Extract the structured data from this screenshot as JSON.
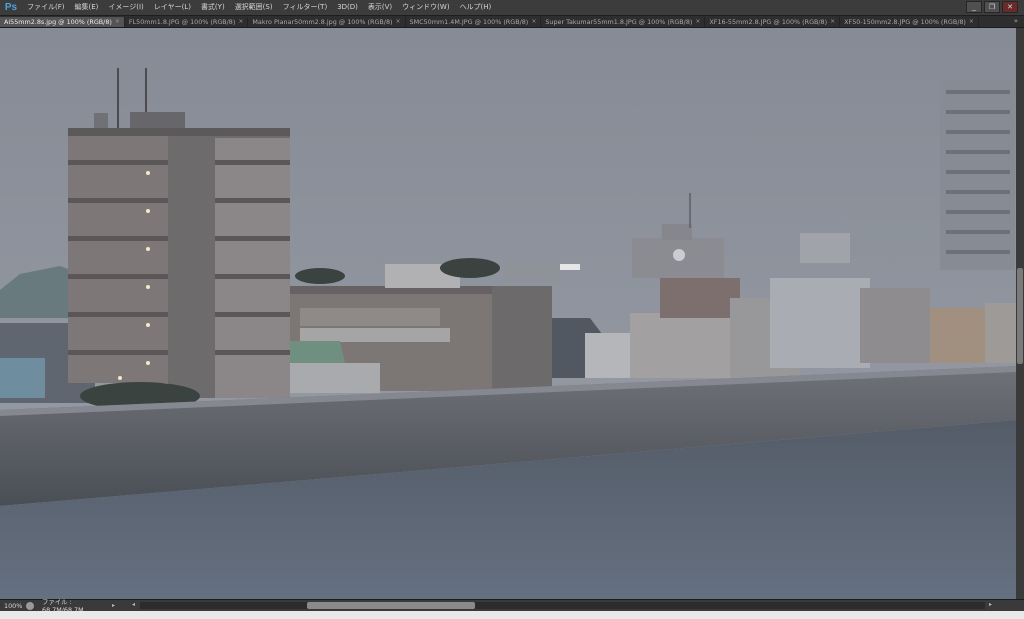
{
  "app": {
    "logo": "Ps"
  },
  "menu": [
    "ファイル(F)",
    "編集(E)",
    "イメージ(I)",
    "レイヤー(L)",
    "書式(Y)",
    "選択範囲(S)",
    "フィルター(T)",
    "3D(D)",
    "表示(V)",
    "ウィンドウ(W)",
    "ヘルプ(H)"
  ],
  "window_controls": {
    "minimize": "_",
    "restore": "❐",
    "close": "✕"
  },
  "tabs": [
    {
      "label": "Ai55mm2.8s.jpg @ 100% (RGB/8)",
      "active": true
    },
    {
      "label": "FL50mm1.8.JPG @ 100% (RGB/8)",
      "active": false
    },
    {
      "label": "Makro Planar50mm2.8.jpg @ 100% (RGB/8)",
      "active": false
    },
    {
      "label": "SMC50mm1.4M.JPG @ 100% (RGB/8)",
      "active": false
    },
    {
      "label": "Super Takumar55mm1.8.JPG @ 100% (RGB/8)",
      "active": false
    },
    {
      "label": "XF16-55mm2.8.JPG @ 100% (RGB/8)",
      "active": false
    },
    {
      "label": "XF50-150mm2.8.JPG @ 100% (RGB/8)",
      "active": false
    }
  ],
  "tab_close_glyph": "×",
  "tab_overflow_glyph": "»",
  "status": {
    "zoom": "100%",
    "doc_info": "ファイル : 68.7M/68.7M",
    "arrow": "▸",
    "scroll_left": "◂",
    "scroll_right": "▸"
  },
  "colors": {
    "accent": "#4ba3e3",
    "active_tab": "#545454",
    "canvas_sky": "#8f949e",
    "water": "#5b6470"
  },
  "icons": [
    "photoshop-logo-icon",
    "tab-close-icon",
    "status-info-icon"
  ]
}
